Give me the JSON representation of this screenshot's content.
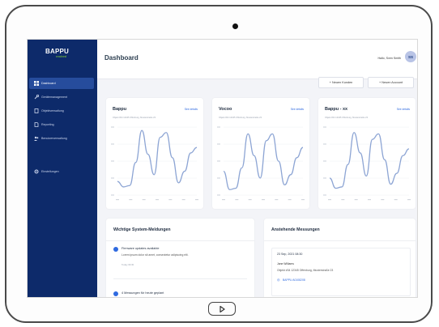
{
  "device": {
    "home_button_icon": "play-icon"
  },
  "sidebar": {
    "logo": {
      "main": "BAPPU",
      "sub": "evolved"
    },
    "items": [
      {
        "label": "Dashboard",
        "icon": "dashboard-icon",
        "active": true
      },
      {
        "label": "Gerätemanagement",
        "icon": "wrench-icon",
        "active": false
      },
      {
        "label": "Objektverwaltung",
        "icon": "building-icon",
        "active": false
      },
      {
        "label": "Reporting",
        "icon": "report-icon",
        "active": false
      },
      {
        "label": "Benutzerverwaltung",
        "icon": "users-icon",
        "active": false
      },
      {
        "label": "Einstellungen",
        "icon": "gear-icon",
        "active": false
      }
    ]
  },
  "header": {
    "title": "Dashboard",
    "greeting": "Hallo, Sven Smith",
    "avatar_initials": "SS"
  },
  "actions": {
    "new_customer": "+ Neuen Kunden",
    "new_account": "+ Neuen Account"
  },
  "cards": [
    {
      "title": "Bappu",
      "link": "See details",
      "subtitle": "Objekt #34 12345 Offenburg, Musterstraße 23"
    },
    {
      "title": "Vocoo",
      "link": "See details",
      "subtitle": "Objekt #34 12345 Offenburg, Musterstraße 23"
    },
    {
      "title": "Bappu - xx",
      "link": "See details",
      "subtitle": "Objekt #34 12345 Offenburg, Musterstraße 23"
    }
  ],
  "system_messages": {
    "title": "Wichtige System-Meldungen",
    "items": [
      {
        "title": "Firmware updates available",
        "text": "Lorem ipsum dolor sit amet, consectetur adipiscing elit.",
        "time": "Today 09:30"
      },
      {
        "title": "4 Messungen für heute geplant",
        "text": "",
        "time": ""
      }
    ]
  },
  "measurements": {
    "title": "Anstehende Messungen",
    "entry": {
      "date": "23 Sep, 2021 08:30",
      "name": "Jane Williams",
      "address": "Objekt #34 12345 Offenburg, Musterstraße 23",
      "device": "BAPPU A0108208"
    }
  },
  "colors": {
    "sidebar": "#0d2a6a",
    "active_nav": "#264c9c",
    "accent": "#2f6ae0",
    "line": "#8da5d4"
  },
  "chart_data": [
    {
      "type": "line",
      "series": [
        {
          "values": [
            20,
            12,
            14,
            48,
            95,
            60,
            30,
            85,
            92,
            55,
            18,
            35,
            62,
            70
          ]
        }
      ]
    },
    {
      "type": "line",
      "series": [
        {
          "values": [
            35,
            8,
            10,
            40,
            90,
            58,
            25,
            80,
            90,
            50,
            15,
            30,
            55,
            70
          ]
        }
      ]
    },
    {
      "type": "line",
      "series": [
        {
          "values": [
            25,
            10,
            12,
            45,
            92,
            62,
            28,
            82,
            90,
            52,
            16,
            32,
            58,
            68
          ]
        }
      ]
    }
  ]
}
